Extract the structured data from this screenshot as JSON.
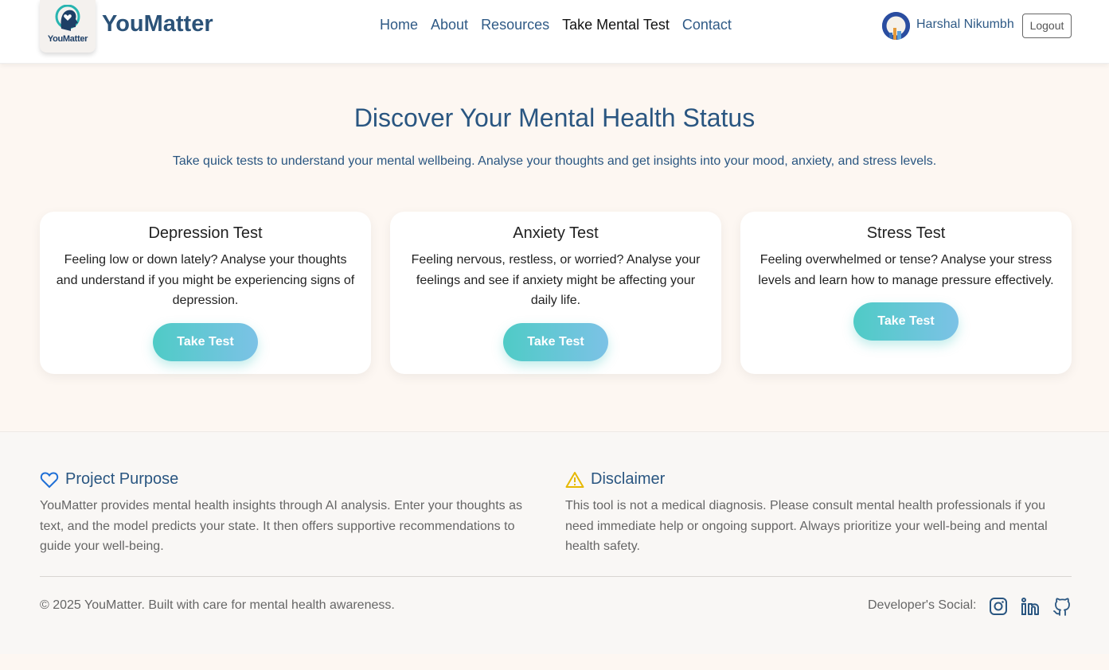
{
  "header": {
    "brand": "YouMatter",
    "logo_text": "YouMatter",
    "nav": [
      {
        "label": "Home",
        "active": false
      },
      {
        "label": "About",
        "active": false
      },
      {
        "label": "Resources",
        "active": false
      },
      {
        "label": "Take Mental Test",
        "active": true
      },
      {
        "label": "Contact",
        "active": false
      }
    ],
    "user_name": "Harshal Nikumbh",
    "logout_label": "Logout"
  },
  "hero": {
    "title": "Discover Your Mental Health Status",
    "subtitle": "Take quick tests to understand your mental wellbeing. Analyse your thoughts and get insights into your mood, anxiety, and stress levels."
  },
  "cards": [
    {
      "title": "Depression Test",
      "description": "Feeling low or down lately? Analyse your thoughts and understand if you might be experiencing signs of depression.",
      "button": "Take Test"
    },
    {
      "title": "Anxiety Test",
      "description": "Feeling nervous, restless, or worried? Analyse your feelings and see if anxiety might be affecting your daily life.",
      "button": "Take Test"
    },
    {
      "title": "Stress Test",
      "description": "Feeling overwhelmed or tense? Analyse your stress levels and learn how to manage pressure effectively.",
      "button": "Take Test"
    }
  ],
  "footer": {
    "purpose_title": "Project Purpose",
    "purpose_text": "YouMatter provides mental health insights through AI analysis. Enter your thoughts as text, and the model predicts your state. It then offers supportive recommendations to guide your well-being.",
    "disclaimer_title": "Disclaimer",
    "disclaimer_text": "This tool is not a medical diagnosis. Please consult mental health professionals if you need immediate help or ongoing support. Always prioritize your well-being and mental health safety.",
    "copyright": "© 2025 YouMatter. Built with care for mental health awareness.",
    "social_label": "Developer's Social:",
    "social_icons": [
      "instagram-icon",
      "linkedin-icon",
      "github-icon"
    ]
  },
  "colors": {
    "primary": "#2a5681",
    "accent_gradient_start": "#4fcbc6",
    "accent_gradient_end": "#7cc2e6",
    "heart_icon": "#1f6fd6",
    "warning_icon": "#e6b800"
  }
}
